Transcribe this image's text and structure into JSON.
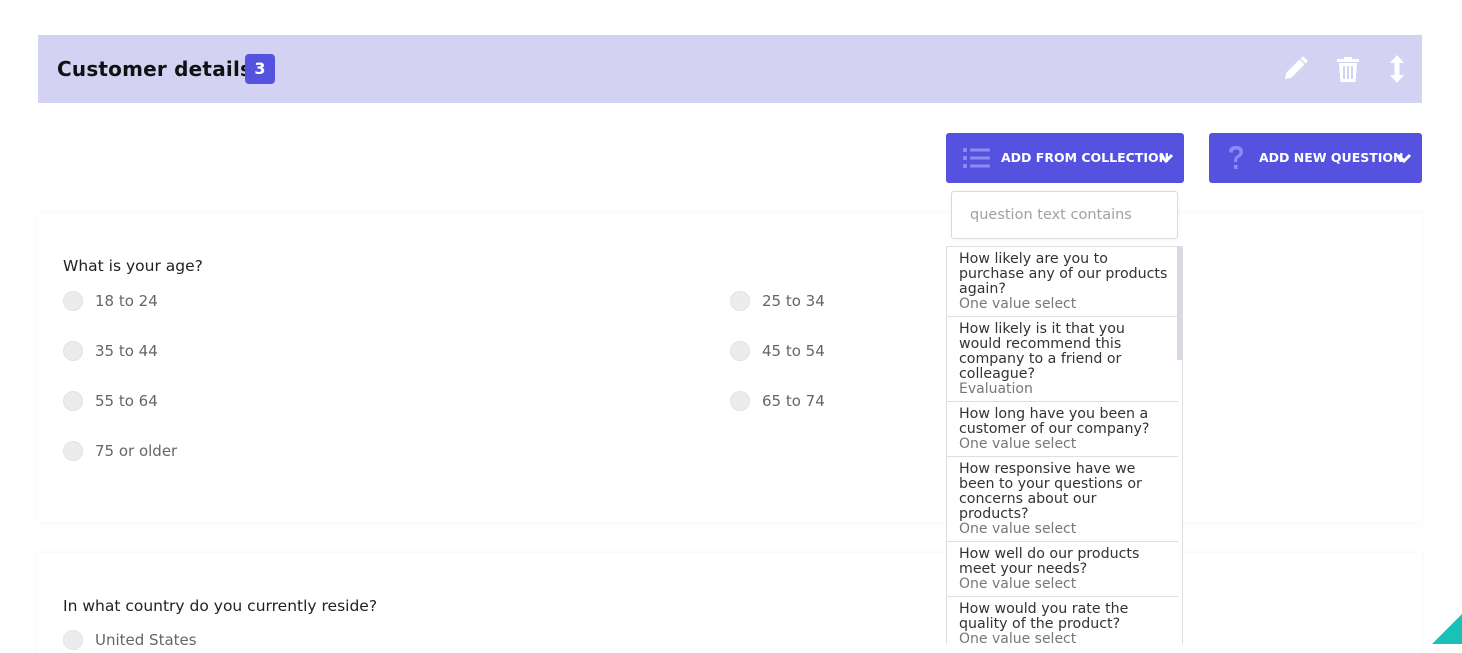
{
  "section": {
    "title": "Customer details",
    "count": "3",
    "icons": [
      "pencil-icon",
      "trash-icon",
      "vertical-arrows-icon"
    ]
  },
  "toolbar": {
    "add_from_collection": "ADD FROM COLLECTION",
    "add_new_question": "ADD NEW QUESTION"
  },
  "dropdown": {
    "search_placeholder": "question text contains",
    "items": [
      {
        "question": "How likely are you to purchase any of our products again?",
        "type": "One value select"
      },
      {
        "question": "How likely is it that you would recommend this company to a friend or colleague?",
        "type": "Evaluation"
      },
      {
        "question": "How long have you been a customer of our company?",
        "type": "One value select"
      },
      {
        "question": "How responsive have we been to your questions or concerns about our products?",
        "type": "One value select"
      },
      {
        "question": "How well do our products meet your needs?",
        "type": "One value select"
      },
      {
        "question": "How would you rate the quality of the product?",
        "type": "One value select"
      }
    ]
  },
  "questions": [
    {
      "title": "What is your age?",
      "options": [
        "18 to 24",
        "25 to 34",
        "35 to 44",
        "45 to 54",
        "55 to 64",
        "65 to 74",
        "75 or older"
      ]
    },
    {
      "title": "In what country do you currently reside?",
      "options": [
        "United States"
      ]
    }
  ],
  "colors": {
    "accent": "#5552df",
    "header_bg": "#d4d2f3",
    "corner": "#19c1b7"
  }
}
